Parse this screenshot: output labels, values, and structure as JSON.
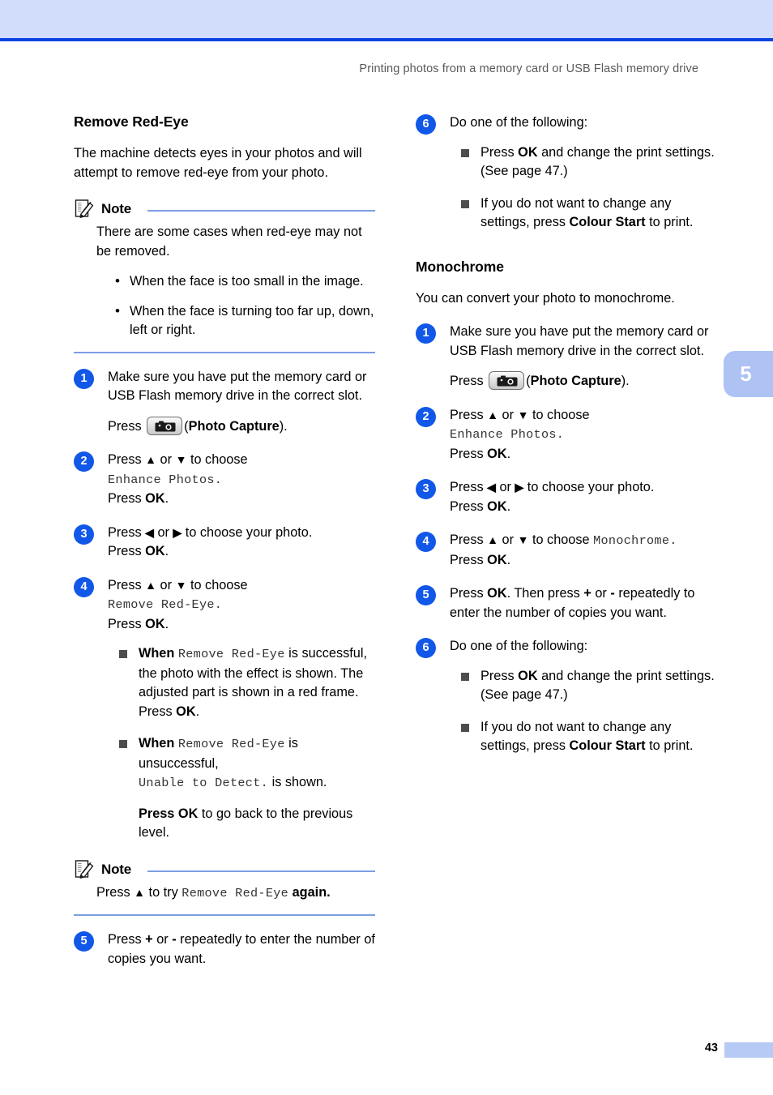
{
  "header": {
    "running_head": "Printing photos from a memory card or USB Flash memory drive"
  },
  "chapter_tab": {
    "number": "5"
  },
  "footer": {
    "page_number": "43"
  },
  "note_label": "Note",
  "left_column": {
    "section": {
      "heading": "Remove Red-Eye",
      "intro": "The machine detects eyes in your photos and will attempt to remove red-eye from your photo."
    },
    "note_1": {
      "label": "Note",
      "intro": "There are some cases when red-eye may not be removed.",
      "bullets": [
        "When the face is too small in the image.",
        "When the face is turning too far up, down, left or right."
      ]
    },
    "steps": [
      {
        "num": "1",
        "line1": "Make sure you have put the memory card or USB Flash memory drive in the correct slot.",
        "press_word": "Press",
        "key_icon": "photo-capture-camera-icon",
        "key_open": "(",
        "key_label": "Photo Capture",
        "key_close": ")."
      },
      {
        "num": "2",
        "line1_pre": "Press",
        "arrow_up": "▲",
        "or": "or",
        "arrow_down": "▼",
        "line1_post": "to choose",
        "lcd": "Enhance Photos.",
        "press_pre": "Press",
        "press_key": "OK",
        "press_post": "."
      },
      {
        "num": "3",
        "line1_pre": "Press",
        "arrow_left": "◀",
        "or": "or",
        "arrow_right": "▶",
        "line1_post": "to choose your photo.",
        "press_pre": "Press",
        "press_key": "OK",
        "press_post": "."
      },
      {
        "num": "4",
        "line1_pre": "Press",
        "arrow_up": "▲",
        "or": "or",
        "arrow_down": "▼",
        "line1_post": "to choose",
        "lcd": "Remove Red-Eye.",
        "press_pre": "Press",
        "press_key": "OK",
        "press_post": ".",
        "bullets": [
          {
            "pre": "When",
            "lcd": "Remove Red-Eye",
            "post": "is successful, the photo with the effect is shown. The adjusted part is shown in a red frame. Press",
            "key": "OK",
            "tail": "."
          },
          {
            "pre": "When",
            "lcd": "Remove Red-Eye",
            "post": "is unsuccessful,",
            "lcd2": "Unable to Detect.",
            "post2": "is shown.",
            "extra_pre": "Press",
            "extra_key": "OK",
            "extra_post": "to go back to the previous level."
          }
        ]
      }
    ],
    "note_2": {
      "label": "Note",
      "pre": "Press",
      "arrow_up": "▲",
      "mid": "to try",
      "lcd": "Remove Red-Eye",
      "post": "again."
    },
    "step_5": {
      "num": "5",
      "pre": "Press",
      "plus": "+",
      "or": "or",
      "minus": "-",
      "post": "repeatedly to enter the number of copies you want."
    }
  },
  "right_column": {
    "step_6_top": {
      "num": "6",
      "intro": "Do one of the following:",
      "bullets": [
        {
          "pre": "Press",
          "key": "OK",
          "post": "and change the print settings. (See page 47.)"
        },
        {
          "pre": "If you do not want to change any settings, press",
          "key": "Colour Start",
          "post": "to print."
        }
      ]
    },
    "section": {
      "heading": "Monochrome",
      "intro": "You can convert your photo to monochrome."
    },
    "steps": [
      {
        "num": "1",
        "line1": "Make sure you have put the memory card or USB Flash memory drive in the correct slot.",
        "press_word": "Press",
        "key_icon": "photo-capture-camera-icon",
        "key_open": "(",
        "key_label": "Photo Capture",
        "key_close": ")."
      },
      {
        "num": "2",
        "line1_pre": "Press",
        "arrow_up": "▲",
        "or": "or",
        "arrow_down": "▼",
        "line1_post": "to choose",
        "lcd": "Enhance Photos.",
        "press_pre": "Press",
        "press_key": "OK",
        "press_post": "."
      },
      {
        "num": "3",
        "line1_pre": "Press",
        "arrow_left": "◀",
        "or": "or",
        "arrow_right": "▶",
        "line1_post": "to choose your photo.",
        "press_pre": "Press",
        "press_key": "OK",
        "press_post": "."
      },
      {
        "num": "4",
        "line1_pre": "Press",
        "arrow_up": "▲",
        "or": "or",
        "arrow_down": "▼",
        "line1_post": "to choose",
        "lcd": "Monochrome.",
        "press_pre": "Press",
        "press_key": "OK",
        "press_post": "."
      },
      {
        "num": "5",
        "pre": "Press",
        "key": "OK",
        "mid": ". Then press",
        "plus": "+",
        "or": "or",
        "minus": "-",
        "post": "repeatedly to enter the number of copies you want."
      },
      {
        "num": "6",
        "intro": "Do one of the following:",
        "bullets": [
          {
            "pre": "Press",
            "key": "OK",
            "post": "and change the print settings. (See page 47.)"
          },
          {
            "pre": "If you do not want to change any settings, press",
            "key": "Colour Start",
            "post": "to print."
          }
        ]
      }
    ]
  }
}
